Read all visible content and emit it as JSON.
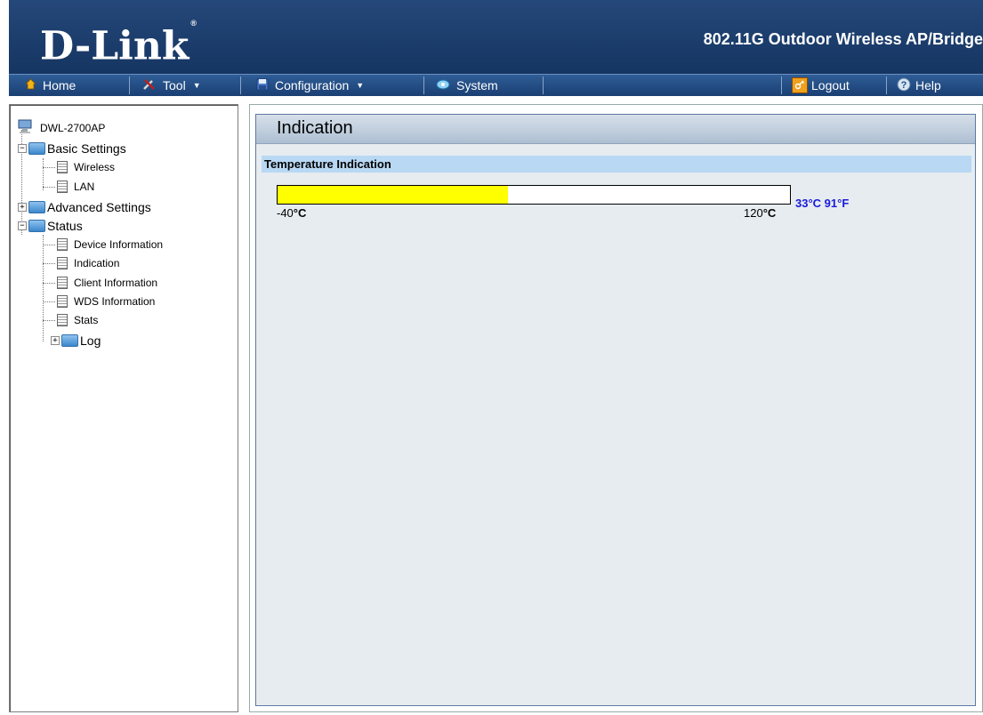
{
  "header": {
    "logo": "D-Link",
    "logo_mark": "®",
    "product_title": "802.11G Outdoor Wireless AP/Bridge"
  },
  "nav": {
    "home": "Home",
    "tool": "Tool",
    "configuration": "Configuration",
    "system": "System",
    "logout": "Logout",
    "help": "Help"
  },
  "tree": {
    "root": "DWL-2700AP",
    "basic_settings": "Basic Settings",
    "wireless": "Wireless",
    "lan": "LAN",
    "advanced_settings": "Advanced Settings",
    "status": "Status",
    "device_information": "Device Information",
    "indication": "Indication",
    "client_information": "Client Information",
    "wds_information": "WDS Information",
    "stats": "Stats",
    "log": "Log"
  },
  "main": {
    "page_title": "Indication",
    "section_title": "Temperature Indication",
    "temp_min": "-40",
    "temp_max": "120",
    "unit_c": "°C",
    "temp_readout": "33°C 91°F",
    "temp_fill_fraction": 0.45,
    "fill_color": "#ffff00"
  }
}
